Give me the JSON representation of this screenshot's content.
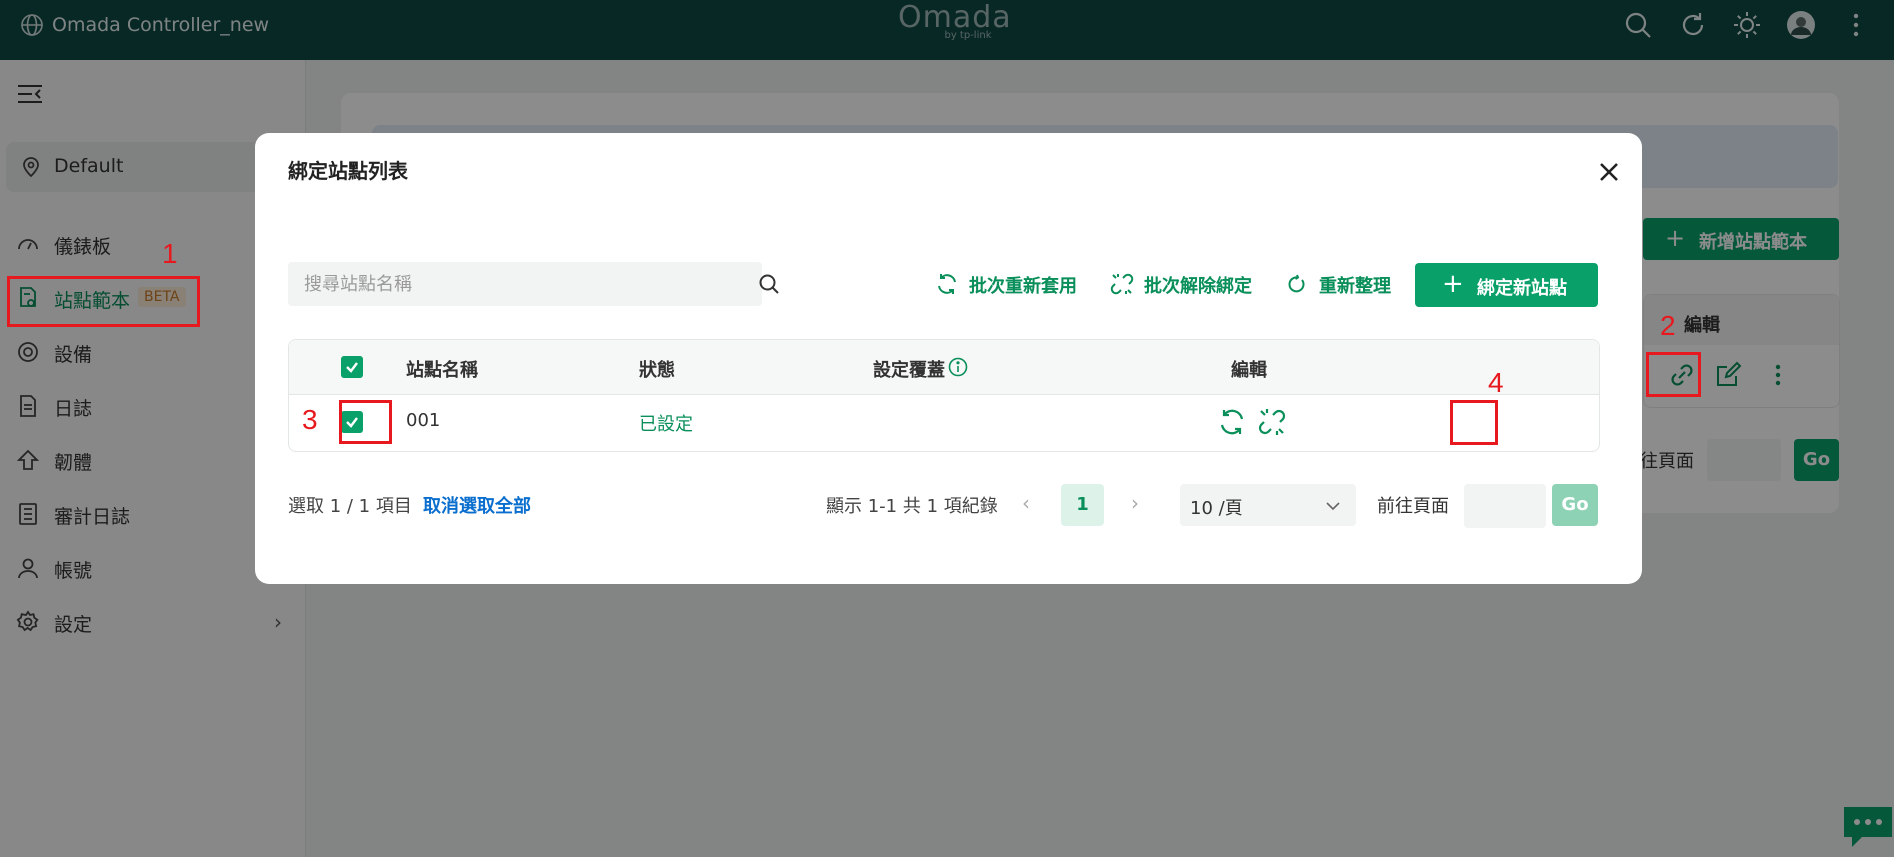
{
  "topbar": {
    "controller_name": "Omada Controller_new",
    "logo_main": "Omada",
    "logo_sub": "by tp-link",
    "icons": [
      "search-icon",
      "refresh-icon",
      "theme-sun-icon",
      "avatar",
      "more-vertical-icon"
    ]
  },
  "sidebar": {
    "site": "Default",
    "items": [
      {
        "label": "儀錶板",
        "icon": "dashboard-icon"
      },
      {
        "label": "站點範本",
        "icon": "site-template-icon",
        "badge": "BETA",
        "active": true
      },
      {
        "label": "設備",
        "icon": "device-icon"
      },
      {
        "label": "日誌",
        "icon": "log-icon"
      },
      {
        "label": "韌體",
        "icon": "firmware-icon"
      },
      {
        "label": "審計日誌",
        "icon": "audit-log-icon"
      },
      {
        "label": "帳號",
        "icon": "account-icon"
      },
      {
        "label": "設定",
        "icon": "settings-icon"
      }
    ]
  },
  "background_page": {
    "add_template_button": "新增站點範本",
    "table_header_edit": "編輯",
    "goto_label": "往頁面",
    "go_button": "Go"
  },
  "modal": {
    "title": "綁定站點列表",
    "search_placeholder": "搜尋站點名稱",
    "toolbar": {
      "batch_reapply": "批次重新套用",
      "batch_unbind": "批次解除綁定",
      "refresh": "重新整理",
      "bind_new_site": "綁定新站點"
    },
    "table": {
      "columns": [
        "站點名稱",
        "狀態",
        "設定覆蓋",
        "編輯"
      ],
      "rows": [
        {
          "name": "001",
          "status": "已設定",
          "checked": true
        }
      ]
    },
    "footer": {
      "selected": "選取 1 / 1 項目",
      "deselect_all": "取消選取全部",
      "total": "顯示 1-1 共 1 項紀錄",
      "current_page": "1",
      "page_size": "10 /頁",
      "goto_label": "前往頁面",
      "go_button": "Go"
    }
  },
  "annotations": {
    "labels": [
      "1",
      "2",
      "3",
      "4"
    ],
    "color": "#e8191e"
  },
  "colors": {
    "topbar": "#0f4a46",
    "accent": "#0aa06a",
    "link": "#0a6ecf"
  }
}
